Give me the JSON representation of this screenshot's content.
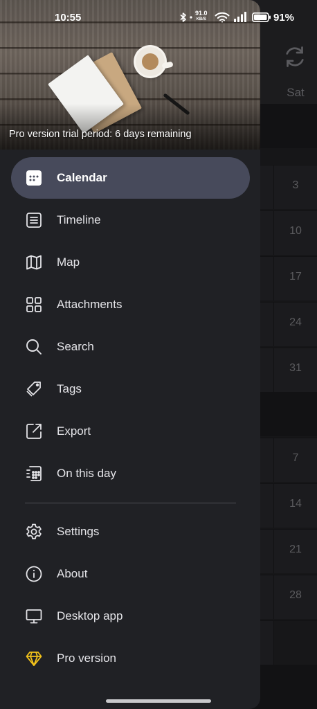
{
  "status_bar": {
    "time": "10:55",
    "net_speed_value": "91.0",
    "net_speed_unit": "KB/S",
    "battery": "91%"
  },
  "background_calendar": {
    "weekday_header": "Sat",
    "dates": [
      "3",
      "10",
      "17",
      "24",
      "31",
      "7",
      "14",
      "21",
      "28"
    ]
  },
  "drawer": {
    "trial_notice": "Pro version trial period: 6 days remaining",
    "items": [
      {
        "label": "Calendar",
        "icon": "calendar-icon",
        "active": true
      },
      {
        "label": "Timeline",
        "icon": "timeline-icon"
      },
      {
        "label": "Map",
        "icon": "map-icon"
      },
      {
        "label": "Attachments",
        "icon": "attachments-icon"
      },
      {
        "label": "Search",
        "icon": "search-icon"
      },
      {
        "label": "Tags",
        "icon": "tags-icon"
      },
      {
        "label": "Export",
        "icon": "export-icon"
      },
      {
        "label": "On this day",
        "icon": "on-this-day-icon"
      }
    ],
    "secondary_items": [
      {
        "label": "Settings",
        "icon": "gear-icon"
      },
      {
        "label": "About",
        "icon": "info-icon"
      },
      {
        "label": "Desktop app",
        "icon": "monitor-icon"
      },
      {
        "label": "Pro version",
        "icon": "diamond-icon",
        "color": "#f2c21b"
      }
    ]
  },
  "colors": {
    "drawer_bg": "#202125",
    "active_item_bg": "#474a5b",
    "pro_accent": "#f2c21b"
  }
}
